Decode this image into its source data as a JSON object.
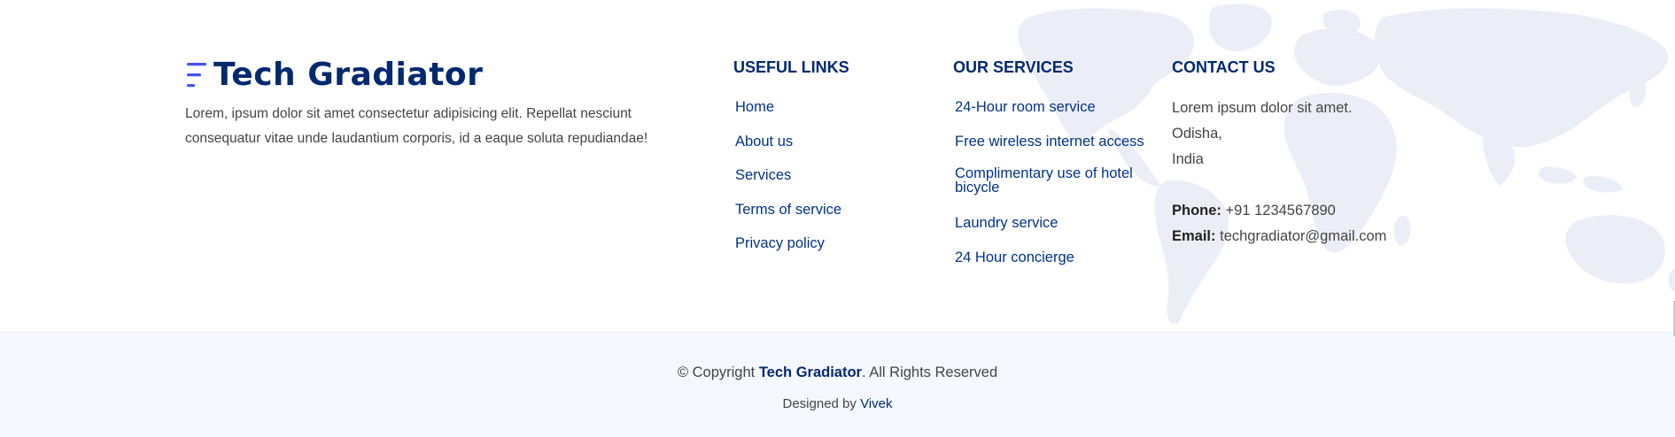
{
  "brand": {
    "name": "Tech Gradiator",
    "description": "Lorem, ipsum dolor sit amet consectetur adipisicing elit. Repellat nesciunt consequatur vitae unde laudantium corporis, id a eaque soluta repudiandae!"
  },
  "useful_links": {
    "title": "USEFUL LINKS",
    "items": [
      {
        "label": "Home"
      },
      {
        "label": "About us"
      },
      {
        "label": "Services"
      },
      {
        "label": "Terms of service"
      },
      {
        "label": "Privacy policy"
      }
    ]
  },
  "services": {
    "title": "OUR SERVICES",
    "items": [
      {
        "label": "24-Hour room service"
      },
      {
        "label": "Free wireless internet access"
      },
      {
        "label": "Complimentary use of hotel bicycle"
      },
      {
        "label": "Laundry service"
      },
      {
        "label": "24 Hour concierge"
      }
    ]
  },
  "contact": {
    "title": "CONTACT US",
    "address_line1": "Lorem ipsum dolor sit amet.",
    "address_line2": "Odisha,",
    "address_line3": "India",
    "phone_label": "Phone:",
    "phone_value": "+91 1234567890",
    "email_label": "Email:",
    "email_value": "techgradiator@gmail.com"
  },
  "footer": {
    "copyright_prefix": "© Copyright",
    "copyright_brand": "Tech Gradiator",
    "copyright_suffix": ". All Rights Reserved",
    "credits_prefix": "Designed by",
    "credits_author": "Vivek"
  },
  "colors": {
    "heading": "#012970",
    "link": "#013289",
    "logo_accent": "#4154f1",
    "bottom_bg": "#f5f8fe",
    "map": "#eceef7"
  },
  "icons": {
    "logo": "menu-lines-logo-icon",
    "background": "world-map-graphic"
  }
}
